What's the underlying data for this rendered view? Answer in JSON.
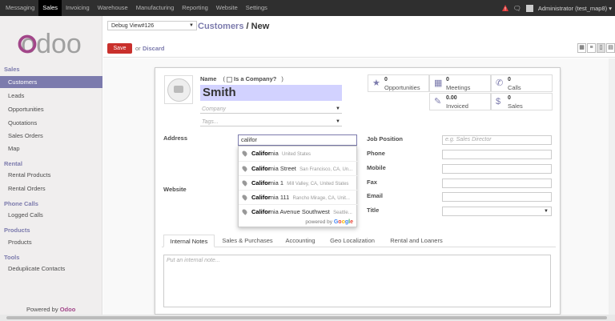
{
  "topbar": {
    "menu": [
      "Messaging",
      "Sales",
      "Invoicing",
      "Warehouse",
      "Manufacturing",
      "Reporting",
      "Website",
      "Settings"
    ],
    "active": "Sales",
    "user": "Administrator (test_map8)",
    "colors": {
      "bg": "#2f2f2f",
      "warning": "#e23b3b"
    }
  },
  "sidebar": {
    "logo_text": "odoo",
    "sections": [
      {
        "title": "Sales",
        "items": [
          "Customers",
          "Leads",
          "Opportunities",
          "Quotations",
          "Sales Orders",
          "Map"
        ]
      },
      {
        "title": "Rental",
        "items": [
          "Rental Products",
          "Rental Orders"
        ]
      },
      {
        "title": "Phone Calls",
        "items": [
          "Logged Calls"
        ]
      },
      {
        "title": "Products",
        "items": [
          "Products"
        ]
      },
      {
        "title": "Tools",
        "items": [
          "Deduplicate Contacts"
        ]
      }
    ],
    "active_item": "Customers",
    "powered_prefix": "Powered by",
    "powered_brand": "Odoo",
    "colors": {
      "accent": "#7c7bad",
      "brand": "#a24689"
    }
  },
  "control": {
    "debug_select": "Debug View#126",
    "breadcrumb_link": "Customers",
    "breadcrumb_sep": "/",
    "breadcrumb_current": "New",
    "save_label": "Save",
    "or_label": "or",
    "discard_label": "Discard",
    "view_icons": [
      "kanban-icon",
      "list-icon",
      "form-icon",
      "map-icon"
    ]
  },
  "form": {
    "name_label": "Name",
    "is_company_label": "Is a Company?",
    "name_value": "Smith",
    "company_placeholder": "Company",
    "tags_placeholder": "Tags...",
    "address_label": "Address",
    "address_value": "califor",
    "website_label": "Website",
    "job_position_label": "Job Position",
    "job_position_placeholder": "e.g. Sales Director",
    "phone_label": "Phone",
    "mobile_label": "Mobile",
    "fax_label": "Fax",
    "email_label": "Email",
    "title_label": "Title"
  },
  "stats": [
    {
      "num": "0",
      "label": "Opportunities",
      "icon": "star-icon"
    },
    {
      "num": "0",
      "label": "Meetings",
      "icon": "calendar-icon"
    },
    {
      "num": "0",
      "label": "Calls",
      "icon": "phone-icon"
    },
    {
      "num": "0.00",
      "label": "Invoiced",
      "icon": "edit-icon"
    },
    {
      "num": "0",
      "label": "Sales",
      "icon": "dollar-icon"
    }
  ],
  "autocomplete": {
    "suggestions": [
      {
        "bold": "Califor",
        "rest": "nia",
        "secondary": "United States"
      },
      {
        "bold": "Califor",
        "rest": "nia Street",
        "secondary": "San Francisco, CA, Un..."
      },
      {
        "bold": "Califor",
        "rest": "nia 1",
        "secondary": "Mill Valley, CA, United States"
      },
      {
        "bold": "Califor",
        "rest": "nia 111",
        "secondary": "Rancho Mirage, CA, Unit..."
      },
      {
        "bold": "Califor",
        "rest": "nia Avenue Southwest",
        "secondary": "Seattle..."
      }
    ],
    "powered_by": "powered by",
    "google": [
      "G",
      "o",
      "o",
      "g",
      "l",
      "e"
    ]
  },
  "tabs": [
    "Internal Notes",
    "Sales & Purchases",
    "Accounting",
    "Geo Localization",
    "Rental and Loaners"
  ],
  "active_tab": "Internal Notes",
  "note_placeholder": "Put an internal note..."
}
